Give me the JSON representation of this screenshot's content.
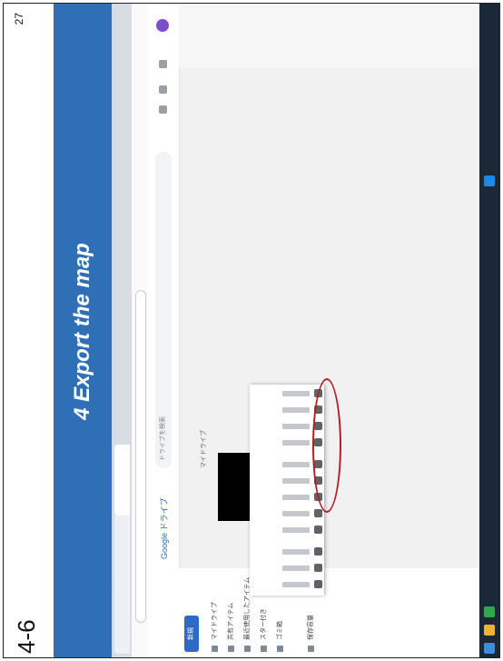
{
  "slide": {
    "number": "4-6",
    "title": "4 Export the map",
    "page_number": "27"
  },
  "screenshot": {
    "logo": "Google ドライブ",
    "new_button": "新規",
    "search_placeholder": "ドライブを検索",
    "section_label": "マイドライブ",
    "sidebar": [
      "マイドライブ",
      "共有アイテム",
      "最近使用したアイテム",
      "スター付き",
      "ゴミ箱",
      "保存容量"
    ],
    "accent_color": "#2f6fb6",
    "highlight_color": "#b01f24"
  }
}
